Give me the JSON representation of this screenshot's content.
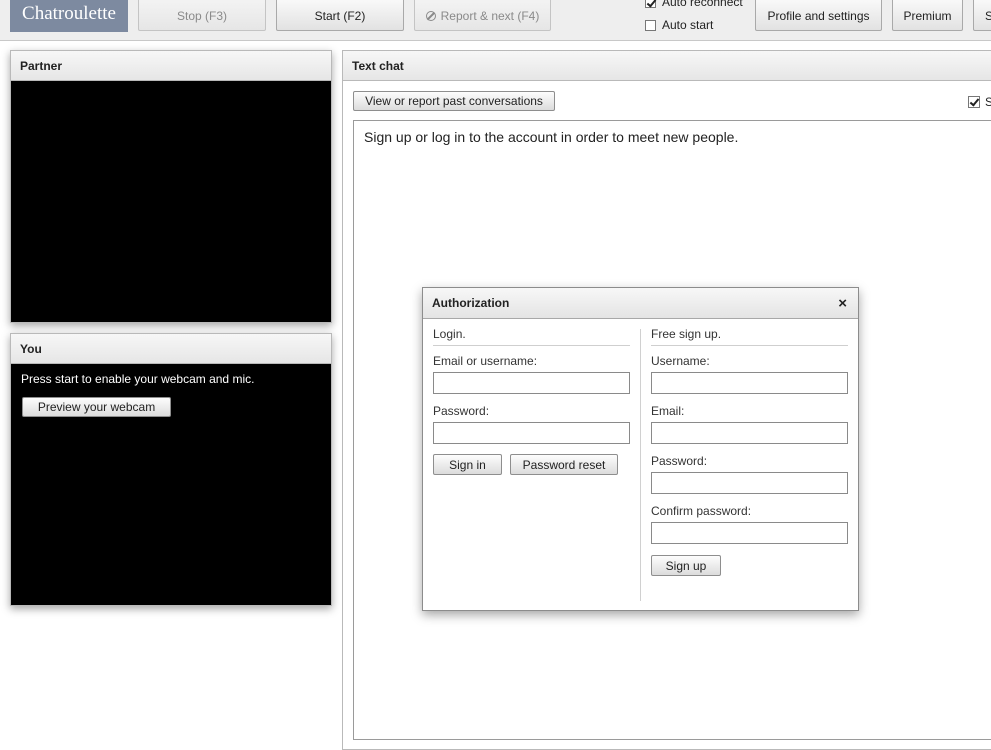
{
  "toolbar": {
    "logo": "Chatroulette",
    "stop_label": "Stop (F3)",
    "start_label": "Start (F2)",
    "report_label": "Report & next (F4)",
    "auto_reconnect": {
      "label": "Auto reconnect",
      "checked": true
    },
    "auto_start": {
      "label": "Auto start",
      "checked": false
    },
    "profile_label": "Profile and settings",
    "premium_label": "Premium",
    "clipped_label": "S"
  },
  "partner_panel": {
    "title": "Partner"
  },
  "you_panel": {
    "title": "You",
    "message": "Press start to enable your webcam and mic.",
    "preview_button": "Preview your webcam"
  },
  "text_chat": {
    "title": "Text chat",
    "history_button": "View or report past conversations",
    "clipped_checkbox_label": "S",
    "clipped_checkbox_checked": true,
    "message": "Sign up or log in to the account in order to meet new people."
  },
  "auth_dialog": {
    "title": "Authorization",
    "close_symbol": "×",
    "login": {
      "heading": "Login.",
      "email_label": "Email or username:",
      "email_value": "",
      "password_label": "Password:",
      "password_value": "",
      "sign_in_button": "Sign in",
      "password_reset_button": "Password reset"
    },
    "signup": {
      "heading": "Free sign up.",
      "username_label": "Username:",
      "email_label": "Email:",
      "password_label": "Password:",
      "confirm_label": "Confirm password:",
      "sign_up_button": "Sign up"
    }
  },
  "colors": {
    "logo_bg": "#7d8aa0",
    "video_bg": "#000000",
    "toolbar_bg": "#eeeeee"
  }
}
